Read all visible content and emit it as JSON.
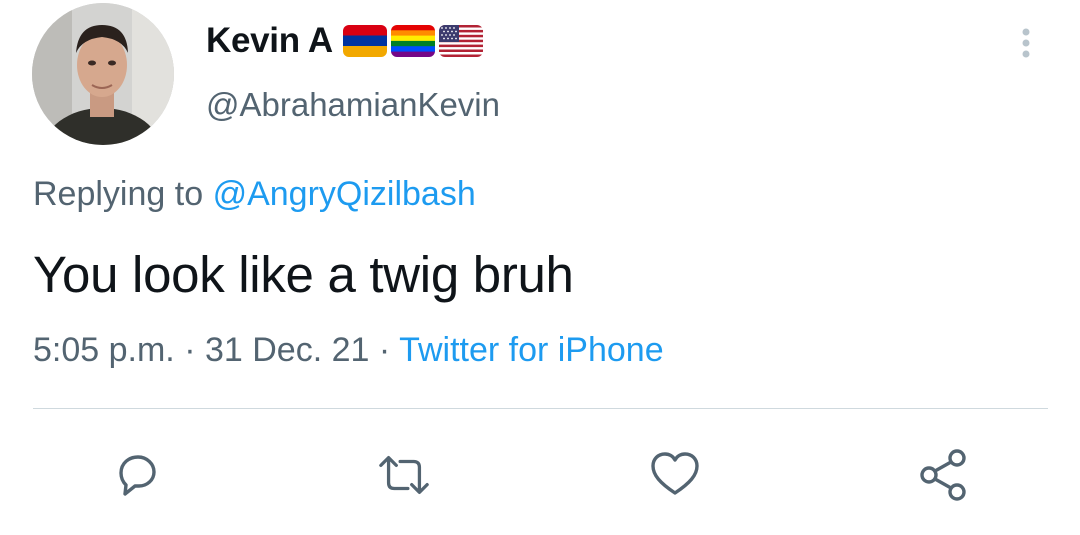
{
  "user": {
    "display_name": "Kevin A",
    "handle": "@AbrahamianKevin",
    "flags": [
      "armenia-flag",
      "rainbow-flag",
      "usa-flag"
    ]
  },
  "reply": {
    "prefix": "Replying to",
    "mention": "@AngryQizilbash"
  },
  "tweet": {
    "text": "You look like a twig bruh"
  },
  "meta": {
    "time": "5:05 p.m.",
    "separator": "·",
    "date": "31 Dec. 21",
    "source": "Twitter for iPhone"
  },
  "actions": {
    "reply_icon": "reply-icon",
    "retweet_icon": "retweet-icon",
    "like_icon": "heart-icon",
    "share_icon": "share-icon"
  },
  "colors": {
    "text_primary": "#0f1419",
    "text_secondary": "#536471",
    "link": "#1d9bf0",
    "divider": "#cfd9de"
  }
}
